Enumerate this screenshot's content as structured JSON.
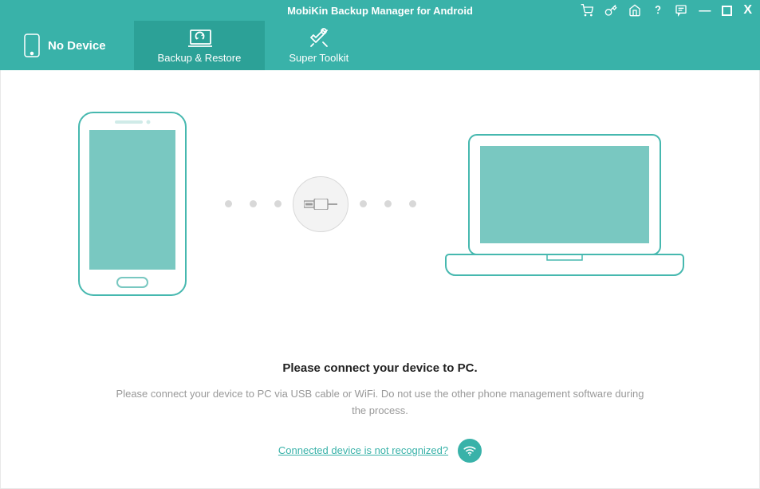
{
  "app": {
    "title": "MobiKin Backup Manager for Android"
  },
  "nav": {
    "device_label": "No Device",
    "backup_label": "Backup & Restore",
    "toolkit_label": "Super Toolkit"
  },
  "main": {
    "heading": "Please connect your device to PC.",
    "description": "Please connect your device to PC via USB cable or WiFi. Do not use the other phone management software during the process.",
    "help_link": "Connected device is not recognized?"
  }
}
